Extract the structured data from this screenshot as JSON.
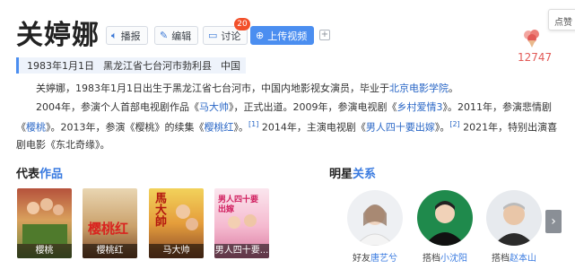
{
  "header": {
    "title": "关婷娜",
    "buttons": {
      "play": "播报",
      "edit": "编辑",
      "discuss": "讨论",
      "discuss_count": "20",
      "upload": "上传视频"
    },
    "like_tag": "点赞",
    "like_count": "12747"
  },
  "info_bar": {
    "birth": "1983年1月1日",
    "birthplace": "黑龙江省七台河市勃利县",
    "country": "中国"
  },
  "summary": {
    "p1_a": "关婷娜，1983年1月1日出生于黑龙江省七台河市，中国内地影视女演员，毕业于",
    "p1_link": "北京电影学院",
    "p1_b": "。",
    "p2_a": "2004年，参演个人首部电视剧作品《",
    "p2_l1": "马大帅",
    "p2_b": "》，正式出道。2009年，参演电视剧《",
    "p2_l2": "乡村爱情3",
    "p2_c": "》。2011年，参演悲情剧《",
    "p2_l3": "樱桃",
    "p2_d": "》。2013年，参演《樱桃》的续集《",
    "p2_l4": "樱桃红",
    "p2_e": "》。",
    "ref1": "[1]",
    "p2_f": " 2014年，主演电视剧《",
    "p2_l5": "男人四十要出嫁",
    "p2_g": "》。",
    "ref2": "[2]",
    "p2_h": " 2021年，特别出演喜剧电影《东北奇缘》。"
  },
  "works": {
    "title_a": "代表",
    "title_b": "作品",
    "items": [
      {
        "label": "樱桃"
      },
      {
        "label": "樱桃红"
      },
      {
        "label": "马大帅"
      },
      {
        "label": "男人四十要..."
      }
    ],
    "poster_texts": [
      "樱桃红",
      "馬大帥",
      "男人四十要出嫁"
    ]
  },
  "relations": {
    "title_a": "明星",
    "title_b": "关系",
    "items": [
      {
        "role": "好友",
        "name": "唐艺兮"
      },
      {
        "role": "搭档",
        "name": "小沈阳"
      },
      {
        "role": "搭档",
        "name": "赵本山"
      }
    ]
  },
  "colors": {
    "accent": "#4b8ef0",
    "link": "#2a67c6",
    "badge": "#f2502a",
    "like": "#e25a57"
  },
  "icons": {
    "play": "speaker-icon",
    "edit": "pencil-icon",
    "discuss": "chat-icon",
    "upload": "plus-circle-icon",
    "more": "chevron-right-icon"
  }
}
